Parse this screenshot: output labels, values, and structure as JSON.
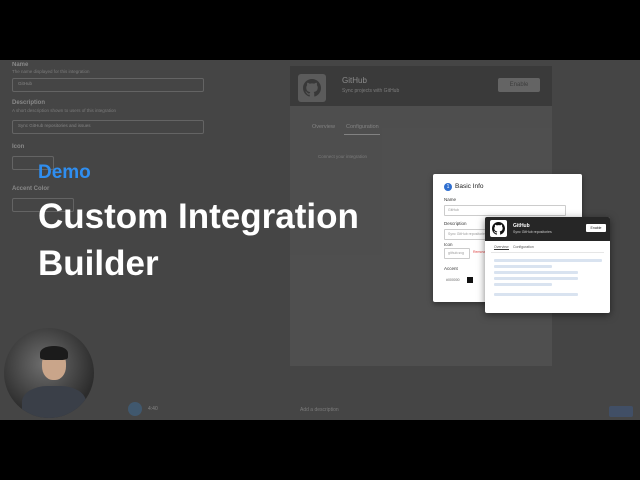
{
  "overlay": {
    "kicker": "Demo",
    "title_line1": "Custom Integration",
    "title_line2": "Builder"
  },
  "background_app": {
    "fields": [
      {
        "label": "Name",
        "hint": "The name displayed for this integration",
        "value": "GitHub"
      },
      {
        "label": "Description",
        "hint": "A short description shown to users of this integration",
        "value": "Sync GitHub repositories and issues"
      },
      {
        "label": "Icon",
        "hint": "",
        "value": ""
      },
      {
        "label": "Accent Color",
        "hint": "",
        "value": ""
      }
    ],
    "preview_card": {
      "name": "GitHub",
      "subtitle": "Sync projects with GitHub",
      "enable_label": "Enable",
      "tabs": [
        "Overview",
        "Configuration"
      ],
      "body_text": "Connect your integration"
    },
    "timestamp": "4:40",
    "footer_note": "Add a description"
  },
  "mock_basic_info": {
    "step": "1",
    "title": "Basic Info",
    "name_label": "Name",
    "name_value": "GitHub",
    "description_label": "Description",
    "description_placeholder": "Sync GitHub repositories",
    "icon_label": "Icon",
    "icon_value": "github.svg",
    "icon_remove": "Remove",
    "accent_label": "Accent",
    "accent_value": "#000000",
    "accent_color": "#111111"
  },
  "mock_preview": {
    "name": "GitHub",
    "subtitle": "Sync GitHub repositories",
    "enable_label": "Enable",
    "tabs": [
      "Overview",
      "Configuration"
    ]
  }
}
